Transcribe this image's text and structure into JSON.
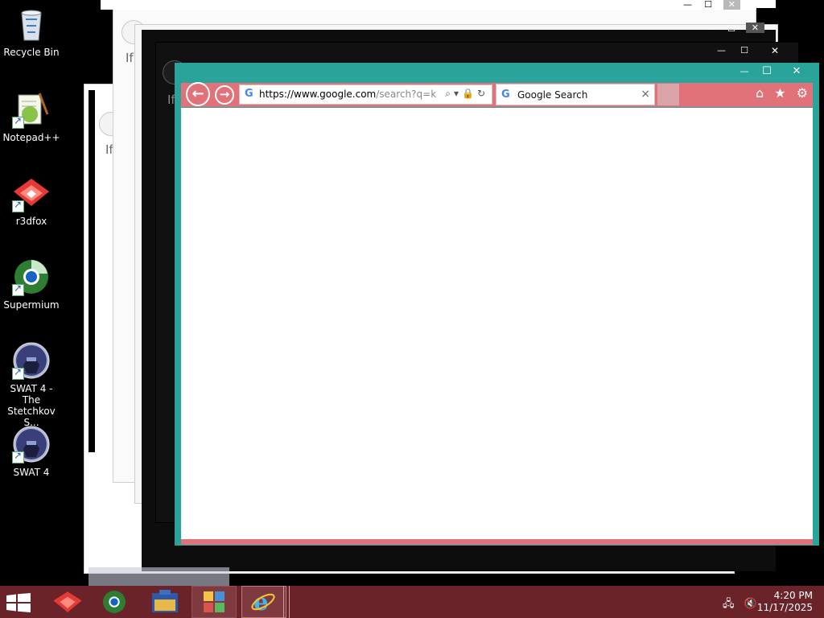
{
  "desktop": {
    "icons": [
      {
        "label": "Recycle Bin",
        "icon": "recycle-bin-icon"
      },
      {
        "label": "Notepad++",
        "icon": "notepad-plus-plus-icon"
      },
      {
        "label": "r3dfox",
        "icon": "r3dfox-icon"
      },
      {
        "label": "Supermium",
        "icon": "supermium-icon"
      },
      {
        "label": "SWAT 4 - The Stetchkov S...",
        "icon": "swat4-expansion-icon"
      },
      {
        "label": "SWAT 4",
        "icon": "swat4-icon"
      }
    ]
  },
  "ghost_windows": {
    "partial_text": "If"
  },
  "browser": {
    "window_controls": {
      "minimize": "—",
      "maximize": "☐",
      "close": "✕"
    },
    "address": {
      "domain": "https://www.google.com",
      "rest": "/search?q=korn"
    },
    "tab": {
      "title": "Google Search",
      "close": "×"
    },
    "accent_color": "#e2727a",
    "frame_color": "#2aa39a"
  },
  "taskbar": {
    "items": [
      "start",
      "r3dfox",
      "supermium",
      "file-explorer",
      "control-panel",
      "internet-explorer"
    ],
    "clock": {
      "time": "4:20 PM",
      "date": "11/17/2025"
    },
    "color": "#6a2329"
  }
}
